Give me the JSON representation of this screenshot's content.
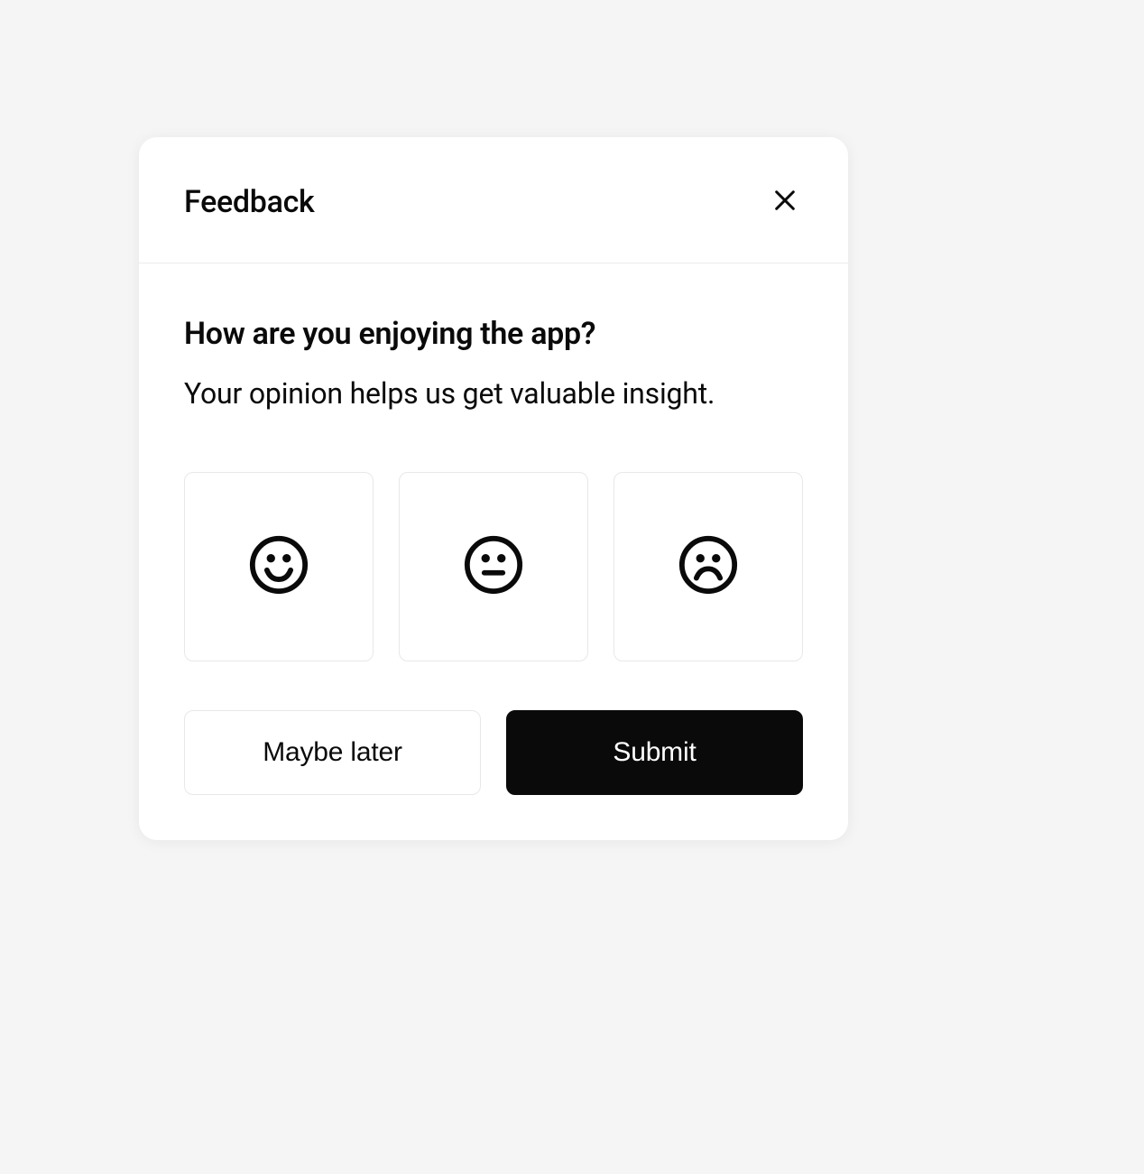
{
  "modal": {
    "title": "Feedback",
    "question": "How are you enjoying the app?",
    "subtext": "Your opinion helps us get valuable insight.",
    "options": {
      "happy": "happy-icon",
      "neutral": "neutral-icon",
      "sad": "sad-icon"
    },
    "actions": {
      "secondary_label": "Maybe later",
      "primary_label": "Submit"
    }
  }
}
